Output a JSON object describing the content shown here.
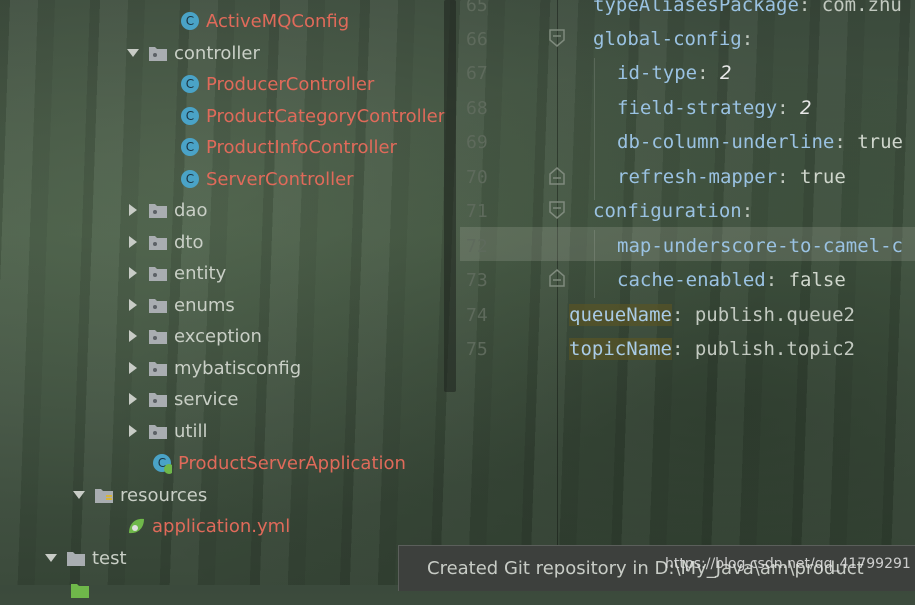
{
  "project_tree": {
    "items": [
      {
        "label": "ActiveMQConfig",
        "type": "class",
        "color": "red"
      },
      {
        "label": "controller",
        "type": "package",
        "expanded": true
      },
      {
        "label": "ProducerController",
        "type": "class",
        "color": "red"
      },
      {
        "label": "ProductCategoryController",
        "type": "class",
        "color": "red"
      },
      {
        "label": "ProductInfoController",
        "type": "class",
        "color": "red"
      },
      {
        "label": "ServerController",
        "type": "class",
        "color": "red"
      },
      {
        "label": "dao",
        "type": "package",
        "expanded": false
      },
      {
        "label": "dto",
        "type": "package",
        "expanded": false
      },
      {
        "label": "entity",
        "type": "package",
        "expanded": false
      },
      {
        "label": "enums",
        "type": "package",
        "expanded": false
      },
      {
        "label": "exception",
        "type": "package",
        "expanded": false
      },
      {
        "label": "mybatisconfig",
        "type": "package",
        "expanded": false
      },
      {
        "label": "service",
        "type": "package",
        "expanded": false
      },
      {
        "label": "utill",
        "type": "package",
        "expanded": false
      },
      {
        "label": "ProductServerApplication",
        "type": "spring-boot-class",
        "color": "red"
      },
      {
        "label": "resources",
        "type": "resources-folder",
        "expanded": true
      },
      {
        "label": "application.yml",
        "type": "spring-yml",
        "color": "red"
      },
      {
        "label": "test",
        "type": "folder",
        "expanded": true
      }
    ]
  },
  "editor": {
    "line_numbers": [
      "65",
      "66",
      "67",
      "68",
      "69",
      "70",
      "71",
      "72",
      "73",
      "74",
      "75"
    ],
    "lines": [
      {
        "key": "typeAliasesPackage",
        "sep": ": ",
        "value": "com.zhu"
      },
      {
        "key": "global-config",
        "sep": ":",
        "value": ""
      },
      {
        "key": "id-type",
        "sep": ": ",
        "value": "2"
      },
      {
        "key": "field-strategy",
        "sep": ": ",
        "value": "2"
      },
      {
        "key": "db-column-underline",
        "sep": ": ",
        "value": "true"
      },
      {
        "key": "refresh-mapper",
        "sep": ": ",
        "value": "true"
      },
      {
        "key": "configuration",
        "sep": ":",
        "value": ""
      },
      {
        "key": "map-underscore-to-camel-c",
        "sep": "",
        "value": ""
      },
      {
        "key": "cache-enabled",
        "sep": ": ",
        "value": "false"
      },
      {
        "key": "queueName",
        "sep": ": ",
        "value": "publish.queue2"
      },
      {
        "key": "topicName",
        "sep": ": ",
        "value": "publish.topic2"
      }
    ]
  },
  "notification": {
    "text": "Created Git repository in D:\\My_Java\\am\\product"
  },
  "watermark": "https://blog.csdn.net/qq_41799291",
  "colors": {
    "red_file": "#e06a5a",
    "yaml_key": "#9ac2e2",
    "highlight": "#5a5523"
  }
}
